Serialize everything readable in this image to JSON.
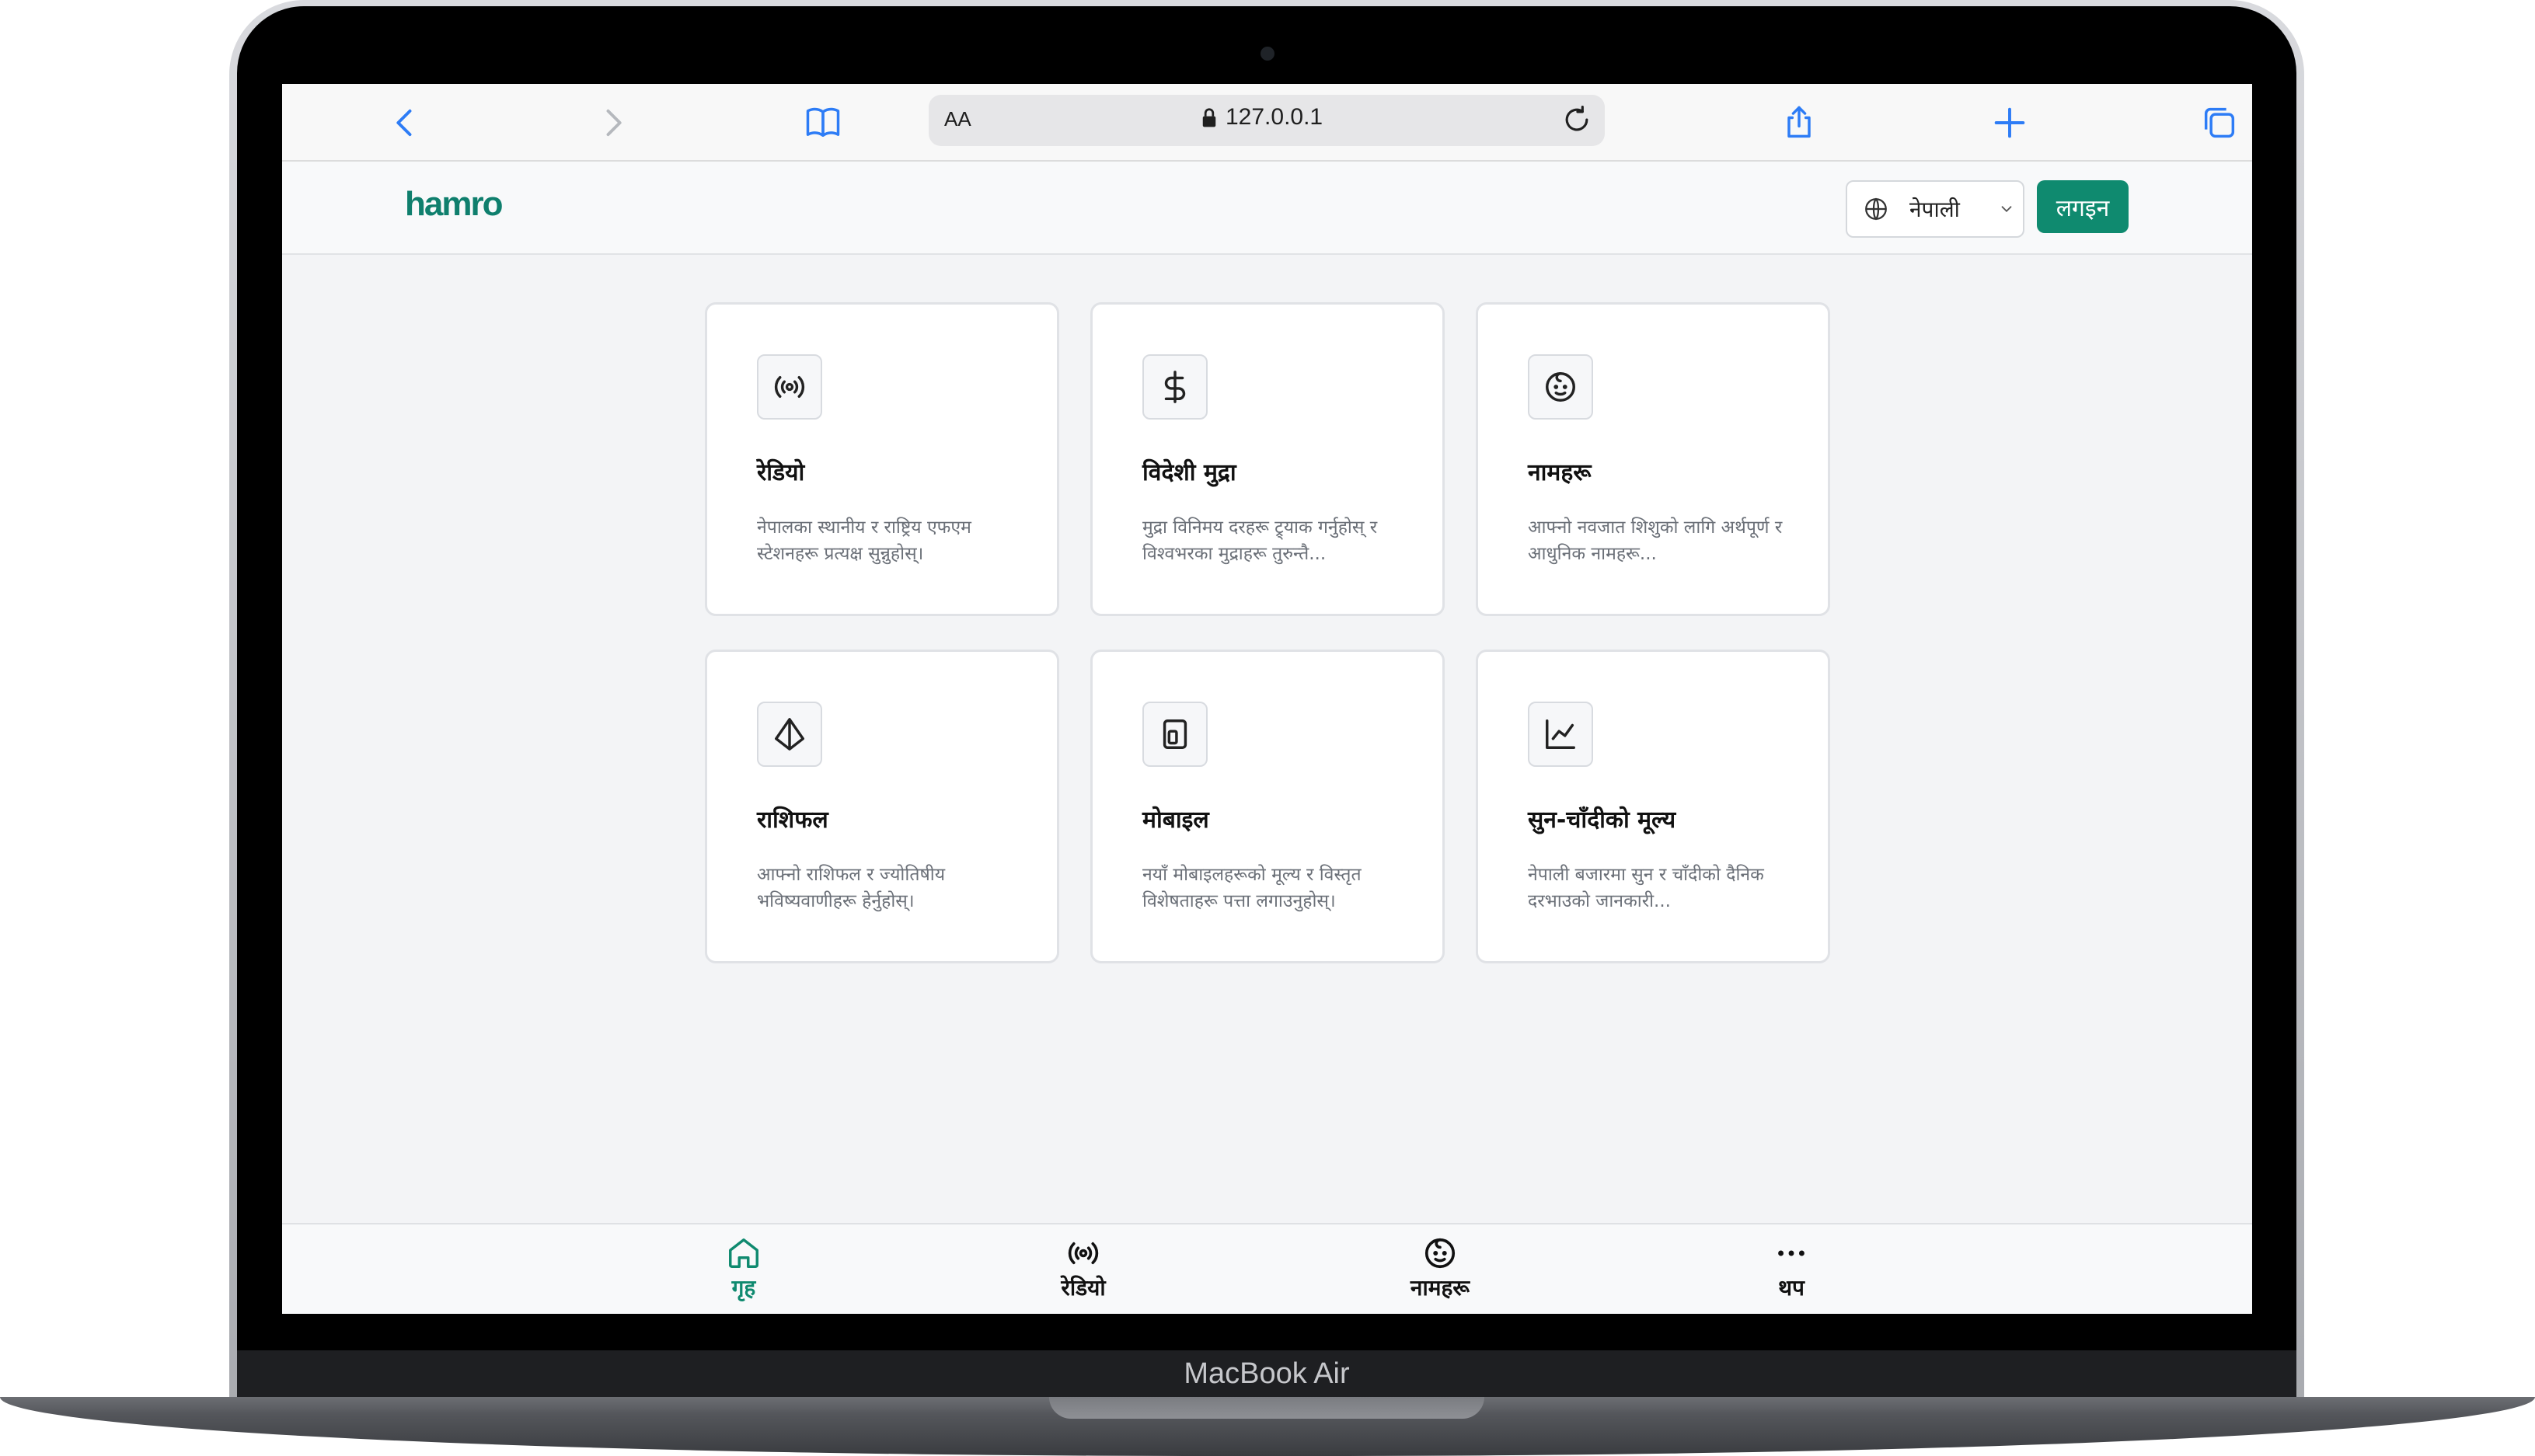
{
  "device": {
    "label": "MacBook Air"
  },
  "browser": {
    "text_size_label": "AA",
    "url": "127.0.0.1"
  },
  "header": {
    "logo": "hamro",
    "language": "नेपाली",
    "login_label": "लगइन"
  },
  "cards": [
    {
      "icon": "radio-broadcast-icon",
      "title": "रेडियो",
      "desc": "नेपालका स्थानीय र राष्ट्रिय एफएम स्टेशनहरू प्रत्यक्ष सुन्नुहोस्।"
    },
    {
      "icon": "dollar-icon",
      "title": "विदेशी मुद्रा",
      "desc": "मुद्रा विनिमय दरहरू ट्र्याक गर्नुहोस् र विश्वभरका मुद्राहरू तुरुन्तै..."
    },
    {
      "icon": "baby-face-icon",
      "title": "नामहरू",
      "desc": "आफ्नो नवजात शिशुको लागि अर्थपूर्ण र आधुनिक नामहरू..."
    },
    {
      "icon": "pyramid-icon",
      "title": "राशिफल",
      "desc": "आफ्नो राशिफल र ज्योतिषीय भविष्यवाणीहरू हेर्नुहोस्।"
    },
    {
      "icon": "mobile-icon",
      "title": "मोबाइल",
      "desc": "नयाँ मोबाइलहरूको मूल्य र विस्तृत विशेषताहरू पत्ता लगाउनुहोस्।"
    },
    {
      "icon": "line-chart-icon",
      "title": "सुन-चाँदीको मूल्य",
      "desc": "नेपाली बजारमा सुन र चाँदीको दैनिक दरभाउको जानकारी..."
    }
  ],
  "bottom_nav": [
    {
      "icon": "home-icon",
      "label": "गृह",
      "active": true
    },
    {
      "icon": "radio-broadcast-icon",
      "label": "रेडियो",
      "active": false
    },
    {
      "icon": "baby-face-icon",
      "label": "नामहरू",
      "active": false
    },
    {
      "icon": "more-icon",
      "label": "थप",
      "active": false
    }
  ],
  "colors": {
    "brand": "#0f8a6f",
    "browser_accent": "#2d7cf6"
  }
}
